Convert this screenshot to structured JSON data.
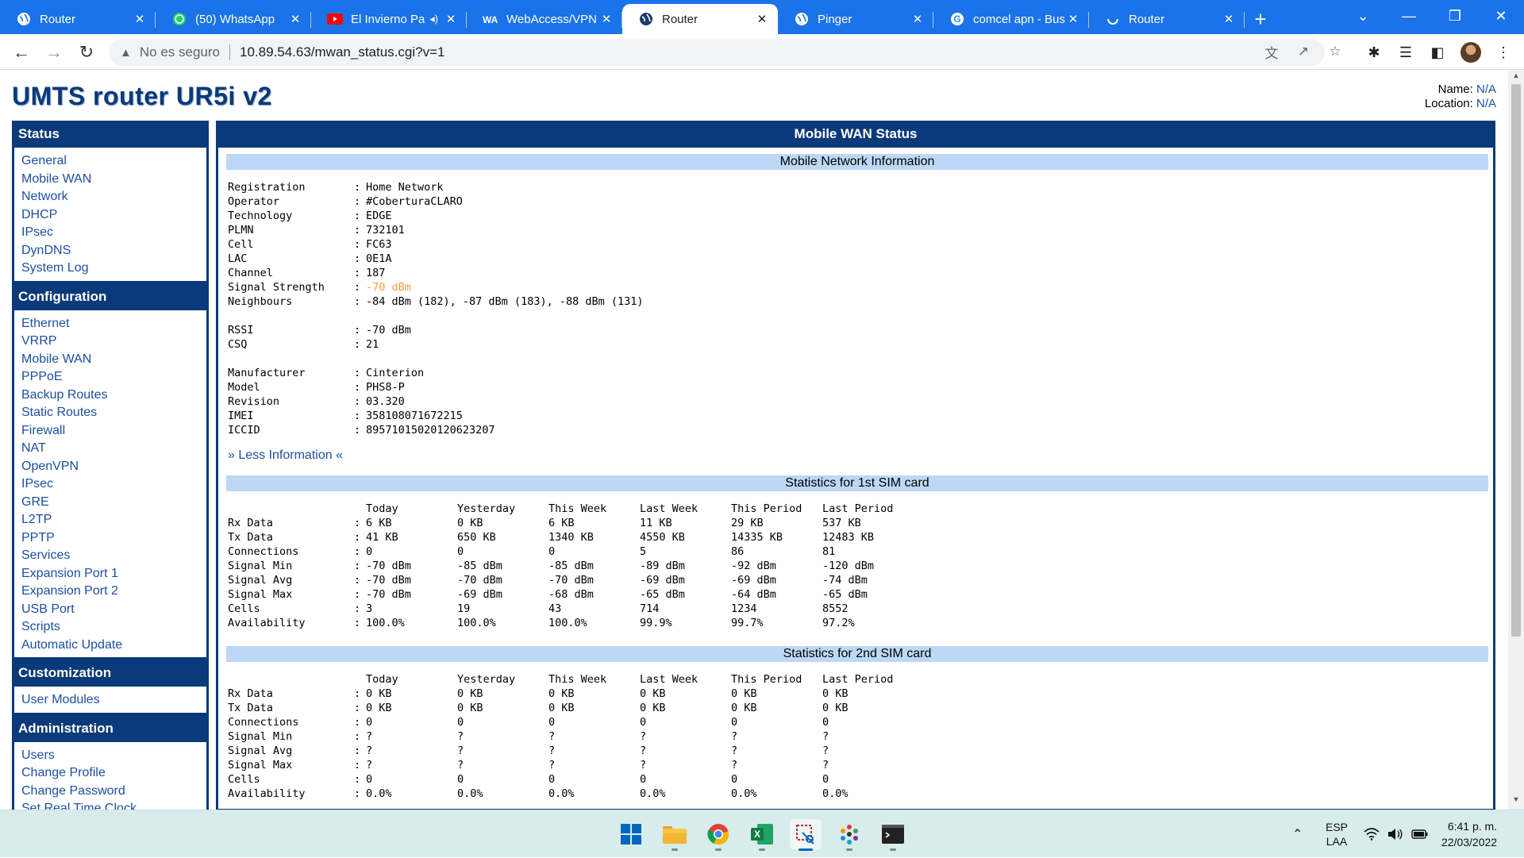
{
  "browser": {
    "tabs": [
      {
        "title": "Router",
        "icon": "router-globe-icon",
        "active": false
      },
      {
        "title": "(50) WhatsApp",
        "icon": "whatsapp-icon",
        "active": false
      },
      {
        "title": "El Invierno Pa",
        "icon": "youtube-icon",
        "active": false,
        "audio": true
      },
      {
        "title": "WebAccess/VPN",
        "icon": "webaccess-icon",
        "active": false
      },
      {
        "title": "Router",
        "icon": "router-globe-icon",
        "active": true
      },
      {
        "title": "Pinger",
        "icon": "router-globe-icon",
        "active": false
      },
      {
        "title": "comcel apn - Bus",
        "icon": "google-icon",
        "active": false
      },
      {
        "title": "Router",
        "icon": "loading-icon",
        "active": false
      }
    ],
    "security_label": "No es seguro",
    "url": "10.89.54.63/mwan_status.cgi?v=1"
  },
  "page": {
    "title": "UMTS router UR5i v2",
    "name_label": "Name:",
    "name_value": "N/A",
    "location_label": "Location:",
    "location_value": "N/A"
  },
  "sidebar": {
    "sections": [
      {
        "title": "Status",
        "items": [
          "General",
          "Mobile WAN",
          "Network",
          "DHCP",
          "IPsec",
          "DynDNS",
          "System Log"
        ]
      },
      {
        "title": "Configuration",
        "items": [
          "Ethernet",
          "VRRP",
          "Mobile WAN",
          "PPPoE",
          "Backup Routes",
          "Static Routes",
          "Firewall",
          "NAT",
          "OpenVPN",
          "IPsec",
          "GRE",
          "L2TP",
          "PPTP",
          "Services",
          "Expansion Port 1",
          "Expansion Port 2",
          "USB Port",
          "Scripts",
          "Automatic Update"
        ]
      },
      {
        "title": "Customization",
        "items": [
          "User Modules"
        ]
      },
      {
        "title": "Administration",
        "items": [
          "Users",
          "Change Profile",
          "Change Password",
          "Set Real Time Clock"
        ]
      }
    ]
  },
  "content": {
    "header": "Mobile WAN Status",
    "network_info": {
      "title": "Mobile Network Information",
      "groups": [
        [
          {
            "key": "Registration",
            "value": "Home Network"
          },
          {
            "key": "Operator",
            "value": "#CoberturaCLARO"
          },
          {
            "key": "Technology",
            "value": "EDGE"
          },
          {
            "key": "PLMN",
            "value": "732101"
          },
          {
            "key": "Cell",
            "value": "FC63"
          },
          {
            "key": "LAC",
            "value": "0E1A"
          },
          {
            "key": "Channel",
            "value": "187"
          },
          {
            "key": "Signal Strength",
            "value": "-70 dBm",
            "highlight": true
          },
          {
            "key": "Neighbours",
            "value": "-84 dBm (182), -87 dBm (183), -88 dBm (131)"
          }
        ],
        [
          {
            "key": "RSSI",
            "value": "-70 dBm"
          },
          {
            "key": "CSQ",
            "value": "21"
          }
        ],
        [
          {
            "key": "Manufacturer",
            "value": "Cinterion"
          },
          {
            "key": "Model",
            "value": "PHS8-P"
          },
          {
            "key": "Revision",
            "value": "03.320"
          },
          {
            "key": "IMEI",
            "value": "358108071672215"
          },
          {
            "key": "ICCID",
            "value": "89571015020120623207"
          }
        ]
      ],
      "less_link": "» Less Information «"
    },
    "sim1": {
      "title": "Statistics for 1st SIM card",
      "columns": [
        "Today",
        "Yesterday",
        "This Week",
        "Last Week",
        "This Period",
        "Last Period"
      ],
      "rows": [
        {
          "label": "Rx Data",
          "values": [
            "6 KB",
            "0 KB",
            "6 KB",
            "11 KB",
            "29 KB",
            "537 KB"
          ]
        },
        {
          "label": "Tx Data",
          "values": [
            "41 KB",
            "650 KB",
            "1340 KB",
            "4550 KB",
            "14335 KB",
            "12483 KB"
          ]
        },
        {
          "label": "Connections",
          "values": [
            "0",
            "0",
            "0",
            "5",
            "86",
            "81"
          ]
        },
        {
          "label": "Signal Min",
          "values": [
            "-70 dBm",
            "-85 dBm",
            "-85 dBm",
            "-89 dBm",
            "-92 dBm",
            "-120 dBm"
          ]
        },
        {
          "label": "Signal Avg",
          "values": [
            "-70 dBm",
            "-70 dBm",
            "-70 dBm",
            "-69 dBm",
            "-69 dBm",
            "-74 dBm"
          ]
        },
        {
          "label": "Signal Max",
          "values": [
            "-70 dBm",
            "-69 dBm",
            "-68 dBm",
            "-65 dBm",
            "-64 dBm",
            "-65 dBm"
          ]
        },
        {
          "label": "Cells",
          "values": [
            "3",
            "19",
            "43",
            "714",
            "1234",
            "8552"
          ]
        },
        {
          "label": "Availability",
          "values": [
            "100.0%",
            "100.0%",
            "100.0%",
            "99.9%",
            "99.7%",
            "97.2%"
          ]
        }
      ]
    },
    "sim2": {
      "title": "Statistics for 2nd SIM card",
      "columns": [
        "Today",
        "Yesterday",
        "This Week",
        "Last Week",
        "This Period",
        "Last Period"
      ],
      "rows": [
        {
          "label": "Rx Data",
          "values": [
            "0 KB",
            "0 KB",
            "0 KB",
            "0 KB",
            "0 KB",
            "0 KB"
          ]
        },
        {
          "label": "Tx Data",
          "values": [
            "0 KB",
            "0 KB",
            "0 KB",
            "0 KB",
            "0 KB",
            "0 KB"
          ]
        },
        {
          "label": "Connections",
          "values": [
            "0",
            "0",
            "0",
            "0",
            "0",
            "0"
          ]
        },
        {
          "label": "Signal Min",
          "values": [
            "?",
            "?",
            "?",
            "?",
            "?",
            "?"
          ]
        },
        {
          "label": "Signal Avg",
          "values": [
            "?",
            "?",
            "?",
            "?",
            "?",
            "?"
          ]
        },
        {
          "label": "Signal Max",
          "values": [
            "?",
            "?",
            "?",
            "?",
            "?",
            "?"
          ]
        },
        {
          "label": "Cells",
          "values": [
            "0",
            "0",
            "0",
            "0",
            "0",
            "0"
          ]
        },
        {
          "label": "Availability",
          "values": [
            "0.0%",
            "0.0%",
            "0.0%",
            "0.0%",
            "0.0%",
            "0.0%"
          ]
        }
      ]
    }
  },
  "taskbar": {
    "apps": [
      {
        "name": "start-button",
        "active": false
      },
      {
        "name": "file-explorer",
        "active": false
      },
      {
        "name": "chrome",
        "active": false
      },
      {
        "name": "excel",
        "active": false
      },
      {
        "name": "snipping-tool",
        "active": true
      },
      {
        "name": "app-dots",
        "active": false
      },
      {
        "name": "terminal",
        "active": false
      }
    ],
    "lang_line1": "ESP",
    "lang_line2": "LAA",
    "time": "6:41 p. m.",
    "date": "22/03/2022"
  },
  "colors": {
    "brand_blue": "#0b3a7a",
    "section_blue": "#bcd8f5",
    "link_blue": "#1c4fa1",
    "chrome_blue": "#1a73e8",
    "signal_orange": "#f0a23c"
  }
}
